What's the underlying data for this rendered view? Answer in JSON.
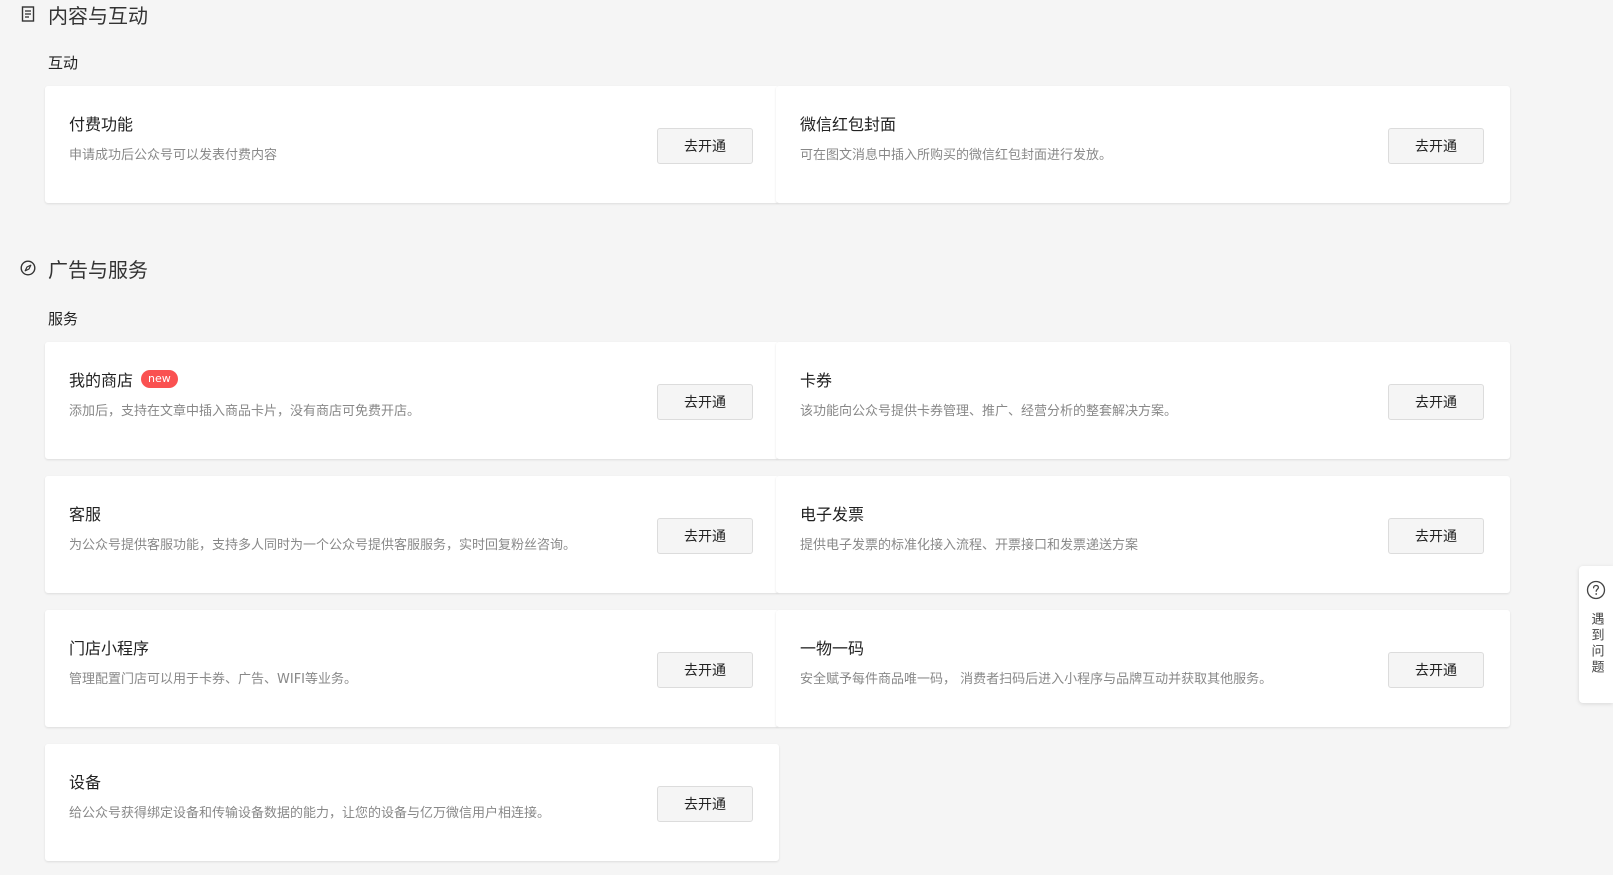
{
  "sections": [
    {
      "title": "内容与互动",
      "icon": "document-icon",
      "group": "互动",
      "cards": [
        {
          "title": "付费功能",
          "desc": "申请成功后公众号可以发表付费内容",
          "button": "去开通"
        },
        {
          "title": "微信红包封面",
          "desc": "可在图文消息中插入所购买的微信红包封面进行发放。",
          "button": "去开通"
        }
      ]
    },
    {
      "title": "广告与服务",
      "icon": "compass-icon",
      "group": "服务",
      "cards": [
        {
          "title": "我的商店",
          "badge": "new",
          "desc": "添加后，支持在文章中插入商品卡片，没有商店可免费开店。",
          "button": "去开通"
        },
        {
          "title": "卡券",
          "desc": "该功能向公众号提供卡券管理、推广、经营分析的整套解决方案。",
          "button": "去开通"
        },
        {
          "title": "客服",
          "desc": "为公众号提供客服功能，支持多人同时为一个公众号提供客服服务，实时回复粉丝咨询。",
          "button": "去开通"
        },
        {
          "title": "电子发票",
          "desc": "提供电子发票的标准化接入流程、开票接口和发票递送方案",
          "button": "去开通"
        },
        {
          "title": "门店小程序",
          "desc": "管理配置门店可以用于卡券、广告、WIFI等业务。",
          "button": "去开通"
        },
        {
          "title": "一物一码",
          "desc": "安全赋予每件商品唯一码， 消费者扫码后进入小程序与品牌互动并获取其他服务。",
          "button": "去开通"
        },
        {
          "title": "设备",
          "desc": "给公众号获得绑定设备和传输设备数据的能力，让您的设备与亿万微信用户相连接。",
          "button": "去开通"
        }
      ]
    }
  ],
  "help": {
    "label": "遇到问题",
    "icon": "question-circle-icon"
  },
  "colors": {
    "badge": "#fa5151",
    "background": "#f5f5f5"
  }
}
